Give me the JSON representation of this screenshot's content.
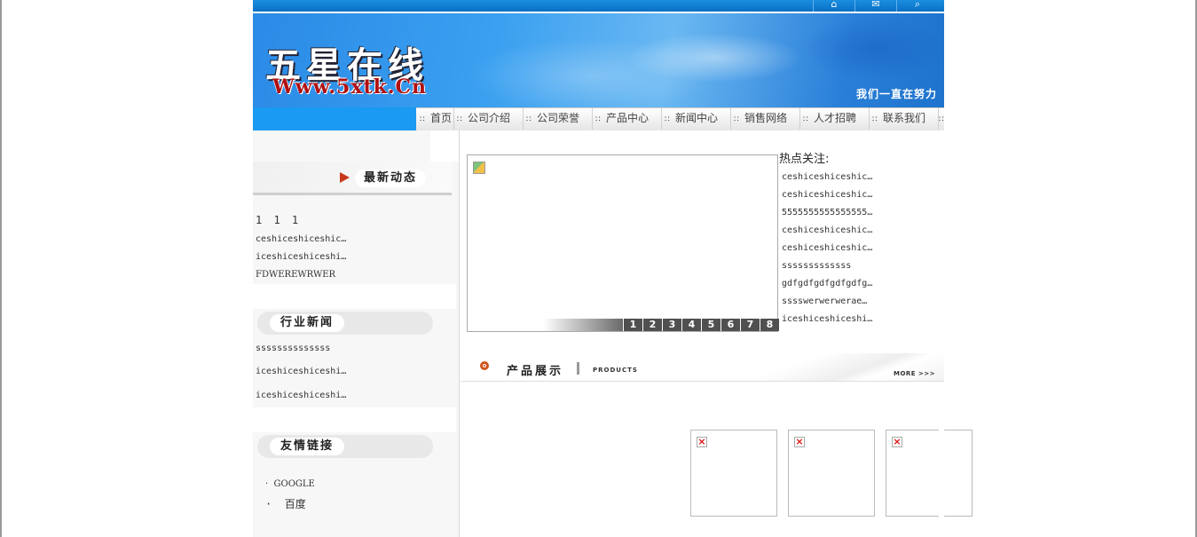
{
  "banner": {
    "logo_text": "五星在线",
    "logo_url": "Www.5xtk.Cn",
    "slogan": "我们一直在努力"
  },
  "top_icons": [
    "home-icon",
    "mail-icon",
    "search-icon"
  ],
  "nav": {
    "items": [
      "首页",
      "公司介绍",
      "公司荣誉",
      "产品中心",
      "新闻中心",
      "销售网络",
      "人才招聘",
      "联系我们"
    ]
  },
  "sidebar": {
    "latest": {
      "title": "最新动态",
      "items": [
        "1 1 1",
        "ceshiceshiceshic…",
        "iceshiceshiceshi…",
        "FDWEREWRWER"
      ]
    },
    "industry": {
      "title": "行业新闻",
      "items": [
        "ssssssssssssss",
        "iceshiceshiceshi…",
        "iceshiceshiceshi…"
      ]
    },
    "links": {
      "title": "友情链接",
      "items": [
        "GOOGLE",
        "百度"
      ]
    }
  },
  "slider": {
    "pages": [
      "1",
      "2",
      "3",
      "4",
      "5",
      "6",
      "7",
      "8"
    ]
  },
  "hot": {
    "title": "热点关注:",
    "items": [
      "ceshiceshiceshic…",
      "ceshiceshiceshic…",
      "5555555555555555…",
      "ceshiceshiceshic…",
      "ceshiceshiceshic…",
      "sssssssssssss",
      "gdfgdfgdfgdfgdfg…",
      "sssswerwerwerae…",
      "iceshiceshiceshi…"
    ]
  },
  "products": {
    "title": "产品展示",
    "subtitle": "PRODUCTS",
    "more_label": "MORE >>>",
    "count": 3
  },
  "colors": {
    "banner_blue": "#2b8ae6",
    "nav_left_blue": "#1a9af2",
    "accent_red": "#c8371a"
  }
}
